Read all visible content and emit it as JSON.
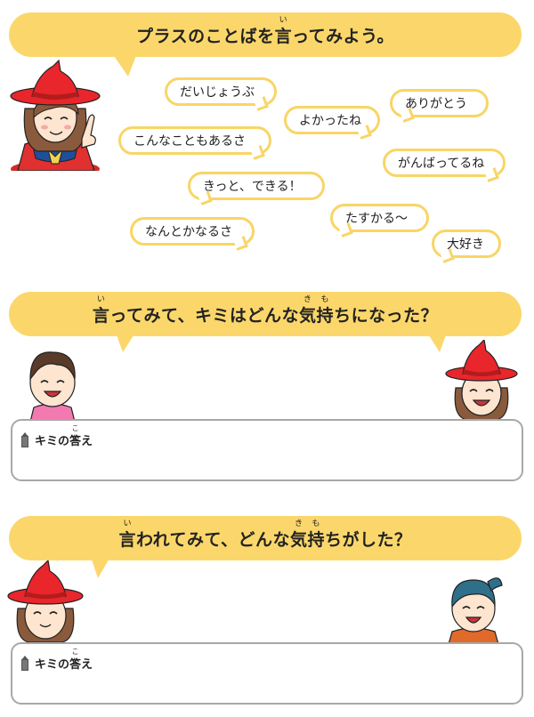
{
  "section1": {
    "heading_pre": "プラスのことばを",
    "heading_kanji": "言",
    "heading_ruby": "い",
    "heading_post": "ってみよう。",
    "phrases": [
      "だいじょうぶ",
      "ありがとう",
      "よかったね",
      "こんなこともあるさ",
      "がんばってるね",
      "きっと、できる！",
      "たすかる〜",
      "なんとかなるさ",
      "大好き"
    ]
  },
  "section2": {
    "heading_k1": "言",
    "heading_r1": "い",
    "heading_mid": "ってみて、キミはどんな",
    "heading_k2": "気",
    "heading_r2": "き",
    "heading_k3": "持",
    "heading_r3": "も",
    "heading_post": "ちになった？",
    "answer_label": "キミの",
    "answer_kanji": "答",
    "answer_ruby": "こた",
    "answer_post": "え"
  },
  "section3": {
    "heading_k1": "言",
    "heading_r1": "い",
    "heading_mid": "われてみて、どんな",
    "heading_k2": "気",
    "heading_r2": "き",
    "heading_k3": "持",
    "heading_r3": "も",
    "heading_post": "ちがした？",
    "answer_label": "キミの",
    "answer_kanji": "答",
    "answer_ruby": "こた",
    "answer_post": "え"
  },
  "colors": {
    "banner": "#fbd76b",
    "bubble_border": "#f8d566",
    "witch_hat": "#e8262c",
    "answer_border": "#a8a8a8"
  }
}
